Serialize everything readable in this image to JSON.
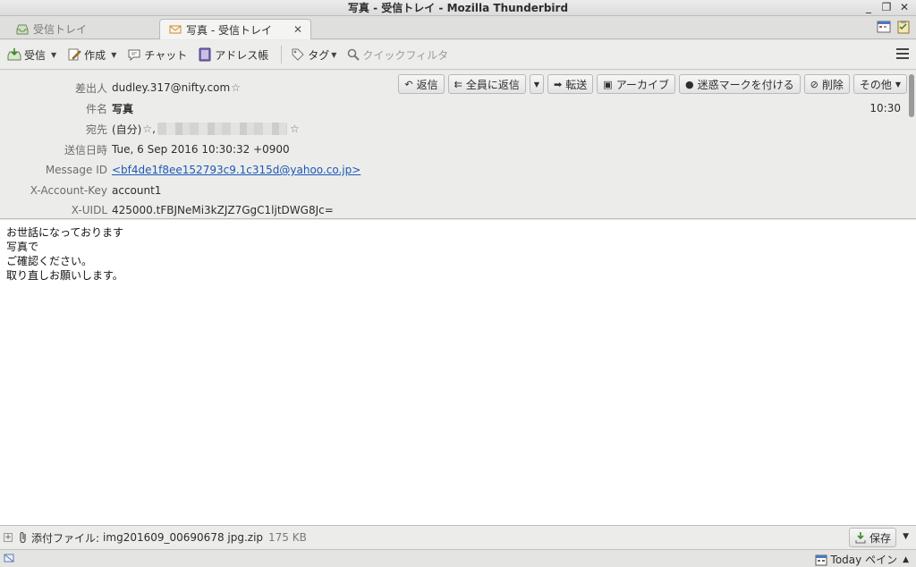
{
  "window": {
    "title": "写真 - 受信トレイ - Mozilla Thunderbird"
  },
  "tabs": [
    {
      "label": "受信トレイ",
      "active": false
    },
    {
      "label": "写真 - 受信トレイ",
      "active": true
    }
  ],
  "toolbar": {
    "get_mail": "受信",
    "write": "作成",
    "chat": "チャット",
    "address_book": "アドレス帳",
    "tag": "タグ",
    "quick_filter": "クイックフィルタ"
  },
  "header_actions": {
    "reply": "返信",
    "reply_all": "全員に返信",
    "forward": "転送",
    "archive": "アーカイブ",
    "junk": "迷惑マークを付ける",
    "delete": "削除",
    "other": "その他"
  },
  "message": {
    "time": "10:30",
    "fields": {
      "from_label": "差出人",
      "from_value": "dudley.317@nifty.com",
      "subject_label": "件名",
      "subject_value": "写真",
      "to_label": "宛先",
      "to_value": "(自分)",
      "date_label": "送信日時",
      "date_value": "Tue, 6 Sep 2016 10:30:32 +0900",
      "msgid_label": "Message ID",
      "msgid_value": "<bf4de1f8ee152793c9.1c315d@yahoo.co.jp>",
      "account_label": "X-Account-Key",
      "account_value": "account1",
      "uidl_label": "X-UIDL",
      "uidl_value": "425000.tFBJNeMi3kZJZ7GgC1ljtDWG8Jc="
    },
    "body_lines": [
      "お世話になっております",
      "",
      "写真で",
      "ご確認ください。",
      "取り直しお願いします。"
    ]
  },
  "attachment": {
    "label": "添付ファイル:",
    "filename": "img201609_00690678 jpg.zip",
    "size": "175 KB",
    "save": "保存"
  },
  "statusbar": {
    "today_pane": "Today ペイン"
  }
}
